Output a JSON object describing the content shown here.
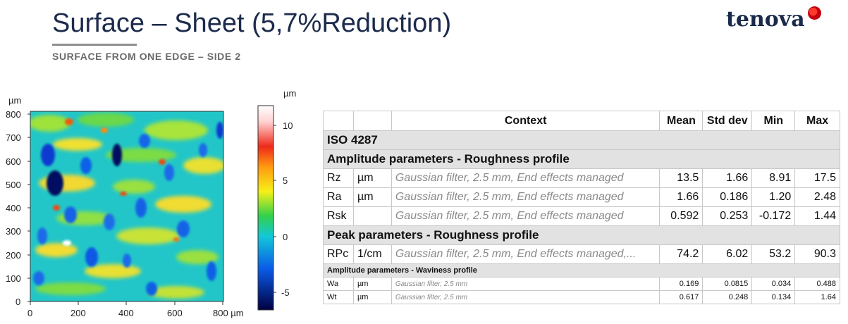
{
  "header": {
    "title": "Surface – Sheet (5,7%Reduction)",
    "subtitle": "SURFACE FROM ONE EDGE – SIDE 2",
    "logo": "tenova"
  },
  "map": {
    "y_unit": "µm",
    "x_unit": "µm",
    "y_ticks": [
      "800",
      "700",
      "600",
      "500",
      "400",
      "300",
      "200",
      "100",
      "0"
    ],
    "x_ticks": [
      "0",
      "200",
      "400",
      "600",
      "800 µm"
    ],
    "colorbar_unit": "µm",
    "colorbar_ticks": [
      "10",
      "5",
      "0",
      "-5"
    ]
  },
  "table": {
    "headers": [
      "",
      "",
      "Context",
      "Mean",
      "Std dev",
      "Min",
      "Max"
    ],
    "standard": "ISO 4287",
    "section1": "Amplitude parameters - Roughness profile",
    "rows1": [
      {
        "param": "Rz",
        "unit": "µm",
        "context": "Gaussian filter, 2.5 mm, End effects managed",
        "mean": "13.5",
        "std": "1.66",
        "min": "8.91",
        "max": "17.5"
      },
      {
        "param": "Ra",
        "unit": "µm",
        "context": "Gaussian filter, 2.5 mm, End effects managed",
        "mean": "1.66",
        "std": "0.186",
        "min": "1.20",
        "max": "2.48"
      },
      {
        "param": "Rsk",
        "unit": "",
        "context": "Gaussian filter, 2.5 mm, End effects managed",
        "mean": "0.592",
        "std": "0.253",
        "min": "-0.172",
        "max": "1.44"
      }
    ],
    "section2": "Peak parameters - Roughness profile",
    "rows2": [
      {
        "param": "RPc",
        "unit": "1/cm",
        "context": "Gaussian filter, 2.5 mm, End effects managed,...",
        "mean": "74.2",
        "std": "6.02",
        "min": "53.2",
        "max": "90.3"
      }
    ],
    "section3": "Amplitude parameters - Waviness profile",
    "rows3": [
      {
        "param": "Wa",
        "unit": "µm",
        "context": "Gaussian filter, 2.5 mm",
        "mean": "0.169",
        "std": "0.0815",
        "min": "0.034",
        "max": "0.488"
      },
      {
        "param": "Wt",
        "unit": "µm",
        "context": "Gaussian filter, 2.5 mm",
        "mean": "0.617",
        "std": "0.248",
        "min": "0.134",
        "max": "1.64"
      }
    ]
  }
}
